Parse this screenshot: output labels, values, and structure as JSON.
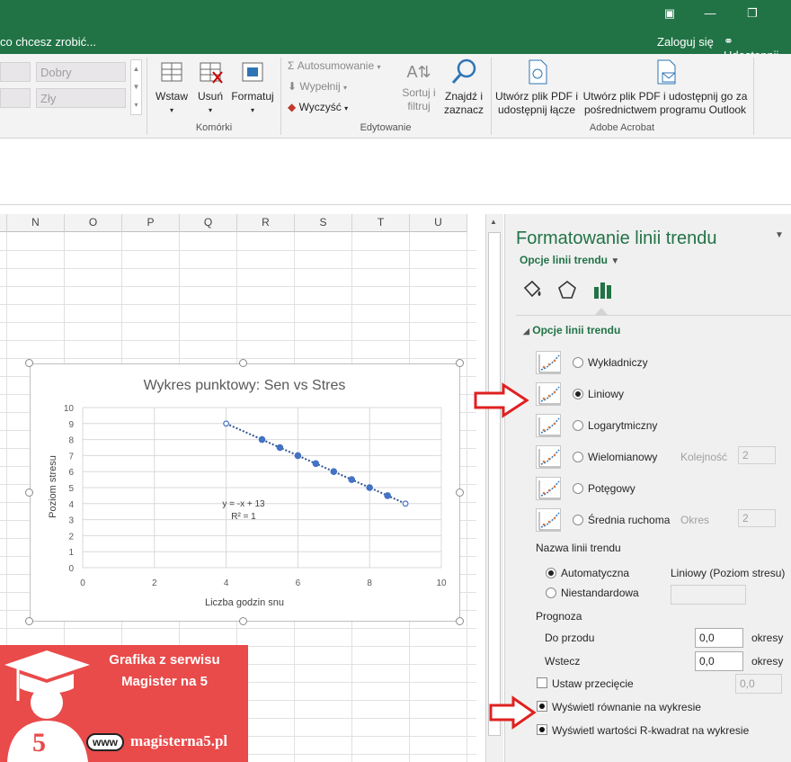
{
  "titlebar": {
    "tell_me": "co chcesz zrobić...",
    "signin": "Zaloguj się",
    "share": "Udostępnij"
  },
  "ribbon": {
    "styles": [
      "Dobry",
      "Zły"
    ],
    "cells": {
      "insert": "Wstaw",
      "delete": "Usuń",
      "format": "Formatuj",
      "group": "Komórki"
    },
    "editing": {
      "autosum": "Autosumowanie",
      "fill": "Wypełnij",
      "clear": "Wyczyść",
      "sort": "Sortuj i",
      "sort2": "filtruj",
      "find": "Znajdź i",
      "find2": "zaznacz",
      "group": "Edytowanie"
    },
    "acrobat": {
      "pdf1a": "Utwórz plik PDF i",
      "pdf1b": "udostępnij łącze",
      "pdf2a": "Utwórz plik PDF i udostępnij go za",
      "pdf2b": "pośrednictwem programu Outlook",
      "group": "Adobe Acrobat"
    }
  },
  "columns": [
    "N",
    "O",
    "P",
    "Q",
    "R",
    "S",
    "T",
    "U"
  ],
  "chart_data": {
    "type": "scatter",
    "title": "Wykres punktowy: Sen vs Stres",
    "xlabel": "Liczba godzin snu",
    "ylabel": "Poziom stresu",
    "xlim": [
      0,
      10
    ],
    "ylim": [
      0,
      10
    ],
    "x_ticks": [
      "0",
      "2",
      "4",
      "6",
      "8",
      "10"
    ],
    "y_ticks": [
      "0",
      "1",
      "2",
      "3",
      "4",
      "5",
      "6",
      "7",
      "8",
      "9",
      "10"
    ],
    "series": [
      {
        "x": [
          4,
          5,
          5.5,
          6,
          6.5,
          7,
          7.5,
          8,
          8.5,
          9
        ],
        "y": [
          9,
          8,
          7.5,
          7,
          6.5,
          6,
          5.5,
          5,
          4.5,
          4
        ]
      }
    ],
    "trendline": {
      "type": "linear",
      "equation": "y = -x + 13",
      "r2": "R² = 1"
    },
    "grid": true,
    "colors": {
      "points": "#4472c4",
      "trend": "#2f5597"
    }
  },
  "pane": {
    "title": "Formatowanie linii trendu",
    "subtitle": "Opcje linii trendu",
    "section": "Opcje linii trendu",
    "options": [
      {
        "label": "Wykładniczy"
      },
      {
        "label": "Liniowy"
      },
      {
        "label": "Logarytmiczny"
      },
      {
        "label": "Wielomianowy",
        "extra_label": "Kolejność",
        "extra_value": "2"
      },
      {
        "label": "Potęgowy"
      },
      {
        "label": "Średnia ruchoma",
        "extra_label": "Okres",
        "extra_value": "2"
      }
    ],
    "name_label": "Nazwa linii trendu",
    "auto_label": "Automatyczna",
    "auto_value": "Liniowy (Poziom stresu)",
    "custom_label": "Niestandardowa",
    "forecast_label": "Prognoza",
    "forward_label": "Do przodu",
    "forward_value": "0,0",
    "backward_label": "Wstecz",
    "backward_value": "0,0",
    "periods": "okresy",
    "intercept_label": "Ustaw przecięcie",
    "intercept_value": "0,0",
    "show_eq": "Wyświetl równanie na wykresie",
    "show_r2": "Wyświetl wartości R-kwadrat na wykresie"
  },
  "logo": {
    "line1": "Grafika z serwisu",
    "line2": "Magister na 5",
    "www": "www",
    "site": "magisterna5.pl",
    "digit": "5"
  }
}
